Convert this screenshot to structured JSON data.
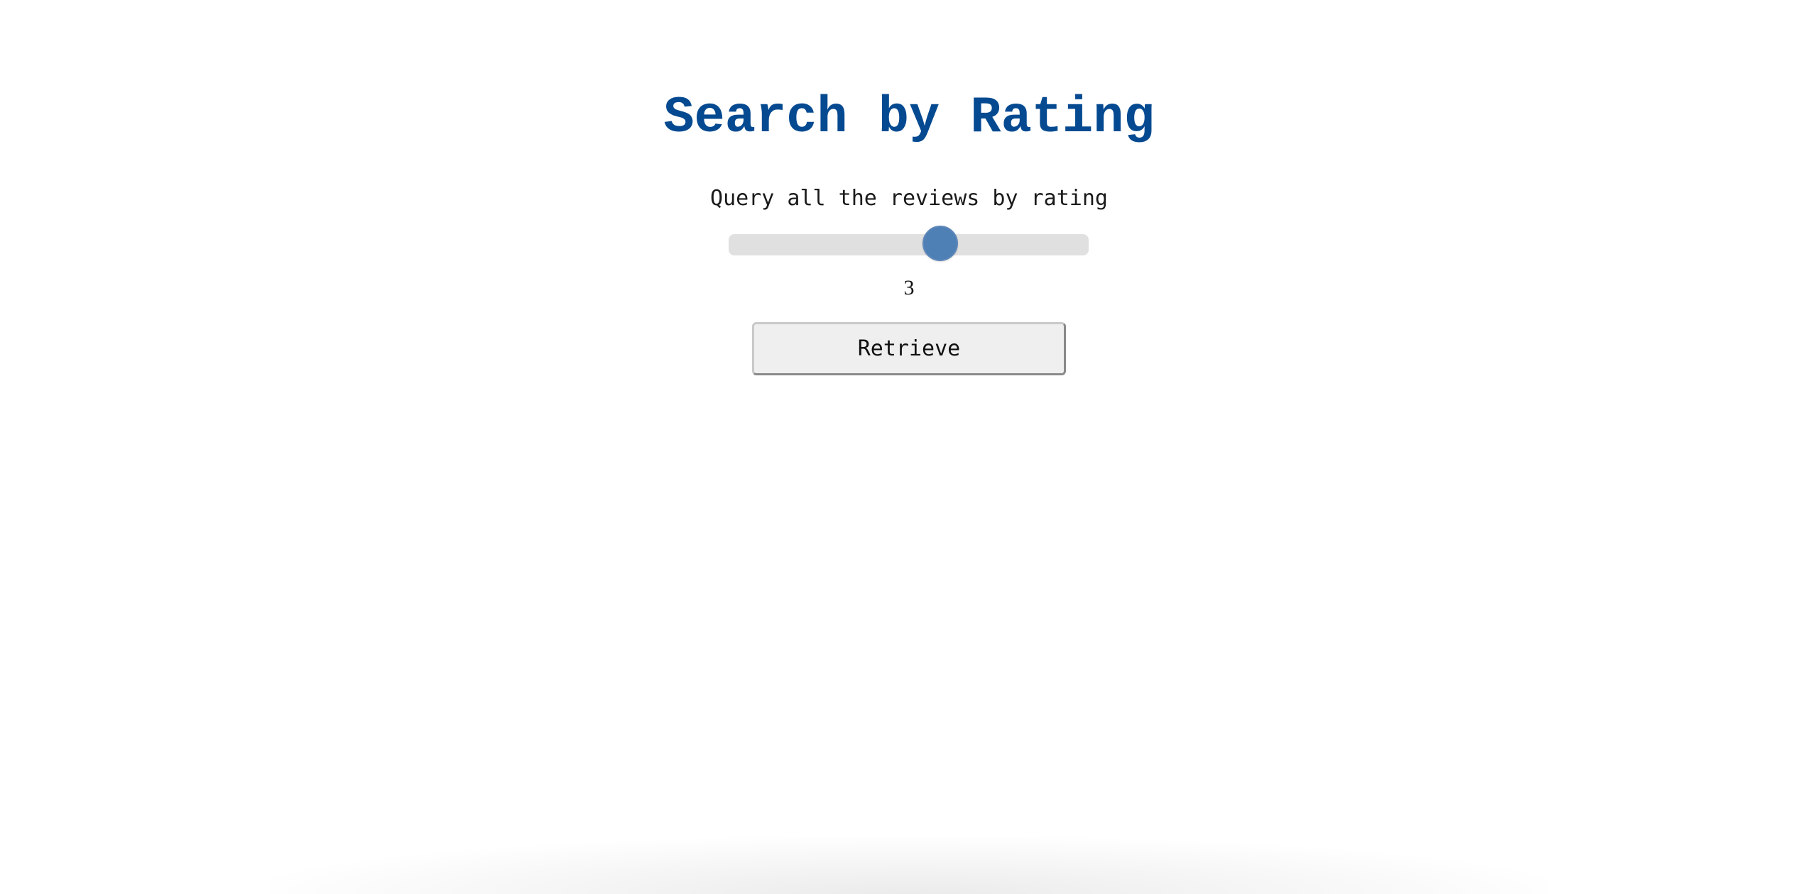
{
  "header": {
    "title": "Search by Rating",
    "subtitle": "Query all the reviews by rating"
  },
  "rating_slider": {
    "min": 0,
    "max": 5,
    "value": 3,
    "value_text": "3"
  },
  "actions": {
    "retrieve_label": "Retrieve"
  },
  "colors": {
    "title": "#054a91",
    "slider_thumb": "#4e7fb5",
    "slider_track": "#e0e0e0",
    "button_background": "#efefef"
  }
}
